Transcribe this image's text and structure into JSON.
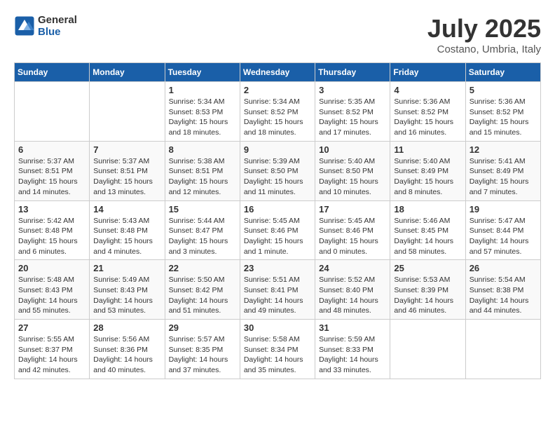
{
  "header": {
    "logo_general": "General",
    "logo_blue": "Blue",
    "month": "July 2025",
    "location": "Costano, Umbria, Italy"
  },
  "days_of_week": [
    "Sunday",
    "Monday",
    "Tuesday",
    "Wednesday",
    "Thursday",
    "Friday",
    "Saturday"
  ],
  "weeks": [
    [
      {
        "day": "",
        "info": ""
      },
      {
        "day": "",
        "info": ""
      },
      {
        "day": "1",
        "info": "Sunrise: 5:34 AM\nSunset: 8:53 PM\nDaylight: 15 hours\nand 18 minutes."
      },
      {
        "day": "2",
        "info": "Sunrise: 5:34 AM\nSunset: 8:52 PM\nDaylight: 15 hours\nand 18 minutes."
      },
      {
        "day": "3",
        "info": "Sunrise: 5:35 AM\nSunset: 8:52 PM\nDaylight: 15 hours\nand 17 minutes."
      },
      {
        "day": "4",
        "info": "Sunrise: 5:36 AM\nSunset: 8:52 PM\nDaylight: 15 hours\nand 16 minutes."
      },
      {
        "day": "5",
        "info": "Sunrise: 5:36 AM\nSunset: 8:52 PM\nDaylight: 15 hours\nand 15 minutes."
      }
    ],
    [
      {
        "day": "6",
        "info": "Sunrise: 5:37 AM\nSunset: 8:51 PM\nDaylight: 15 hours\nand 14 minutes."
      },
      {
        "day": "7",
        "info": "Sunrise: 5:37 AM\nSunset: 8:51 PM\nDaylight: 15 hours\nand 13 minutes."
      },
      {
        "day": "8",
        "info": "Sunrise: 5:38 AM\nSunset: 8:51 PM\nDaylight: 15 hours\nand 12 minutes."
      },
      {
        "day": "9",
        "info": "Sunrise: 5:39 AM\nSunset: 8:50 PM\nDaylight: 15 hours\nand 11 minutes."
      },
      {
        "day": "10",
        "info": "Sunrise: 5:40 AM\nSunset: 8:50 PM\nDaylight: 15 hours\nand 10 minutes."
      },
      {
        "day": "11",
        "info": "Sunrise: 5:40 AM\nSunset: 8:49 PM\nDaylight: 15 hours\nand 8 minutes."
      },
      {
        "day": "12",
        "info": "Sunrise: 5:41 AM\nSunset: 8:49 PM\nDaylight: 15 hours\nand 7 minutes."
      }
    ],
    [
      {
        "day": "13",
        "info": "Sunrise: 5:42 AM\nSunset: 8:48 PM\nDaylight: 15 hours\nand 6 minutes."
      },
      {
        "day": "14",
        "info": "Sunrise: 5:43 AM\nSunset: 8:48 PM\nDaylight: 15 hours\nand 4 minutes."
      },
      {
        "day": "15",
        "info": "Sunrise: 5:44 AM\nSunset: 8:47 PM\nDaylight: 15 hours\nand 3 minutes."
      },
      {
        "day": "16",
        "info": "Sunrise: 5:45 AM\nSunset: 8:46 PM\nDaylight: 15 hours\nand 1 minute."
      },
      {
        "day": "17",
        "info": "Sunrise: 5:45 AM\nSunset: 8:46 PM\nDaylight: 15 hours\nand 0 minutes."
      },
      {
        "day": "18",
        "info": "Sunrise: 5:46 AM\nSunset: 8:45 PM\nDaylight: 14 hours\nand 58 minutes."
      },
      {
        "day": "19",
        "info": "Sunrise: 5:47 AM\nSunset: 8:44 PM\nDaylight: 14 hours\nand 57 minutes."
      }
    ],
    [
      {
        "day": "20",
        "info": "Sunrise: 5:48 AM\nSunset: 8:43 PM\nDaylight: 14 hours\nand 55 minutes."
      },
      {
        "day": "21",
        "info": "Sunrise: 5:49 AM\nSunset: 8:43 PM\nDaylight: 14 hours\nand 53 minutes."
      },
      {
        "day": "22",
        "info": "Sunrise: 5:50 AM\nSunset: 8:42 PM\nDaylight: 14 hours\nand 51 minutes."
      },
      {
        "day": "23",
        "info": "Sunrise: 5:51 AM\nSunset: 8:41 PM\nDaylight: 14 hours\nand 49 minutes."
      },
      {
        "day": "24",
        "info": "Sunrise: 5:52 AM\nSunset: 8:40 PM\nDaylight: 14 hours\nand 48 minutes."
      },
      {
        "day": "25",
        "info": "Sunrise: 5:53 AM\nSunset: 8:39 PM\nDaylight: 14 hours\nand 46 minutes."
      },
      {
        "day": "26",
        "info": "Sunrise: 5:54 AM\nSunset: 8:38 PM\nDaylight: 14 hours\nand 44 minutes."
      }
    ],
    [
      {
        "day": "27",
        "info": "Sunrise: 5:55 AM\nSunset: 8:37 PM\nDaylight: 14 hours\nand 42 minutes."
      },
      {
        "day": "28",
        "info": "Sunrise: 5:56 AM\nSunset: 8:36 PM\nDaylight: 14 hours\nand 40 minutes."
      },
      {
        "day": "29",
        "info": "Sunrise: 5:57 AM\nSunset: 8:35 PM\nDaylight: 14 hours\nand 37 minutes."
      },
      {
        "day": "30",
        "info": "Sunrise: 5:58 AM\nSunset: 8:34 PM\nDaylight: 14 hours\nand 35 minutes."
      },
      {
        "day": "31",
        "info": "Sunrise: 5:59 AM\nSunset: 8:33 PM\nDaylight: 14 hours\nand 33 minutes."
      },
      {
        "day": "",
        "info": ""
      },
      {
        "day": "",
        "info": ""
      }
    ]
  ]
}
